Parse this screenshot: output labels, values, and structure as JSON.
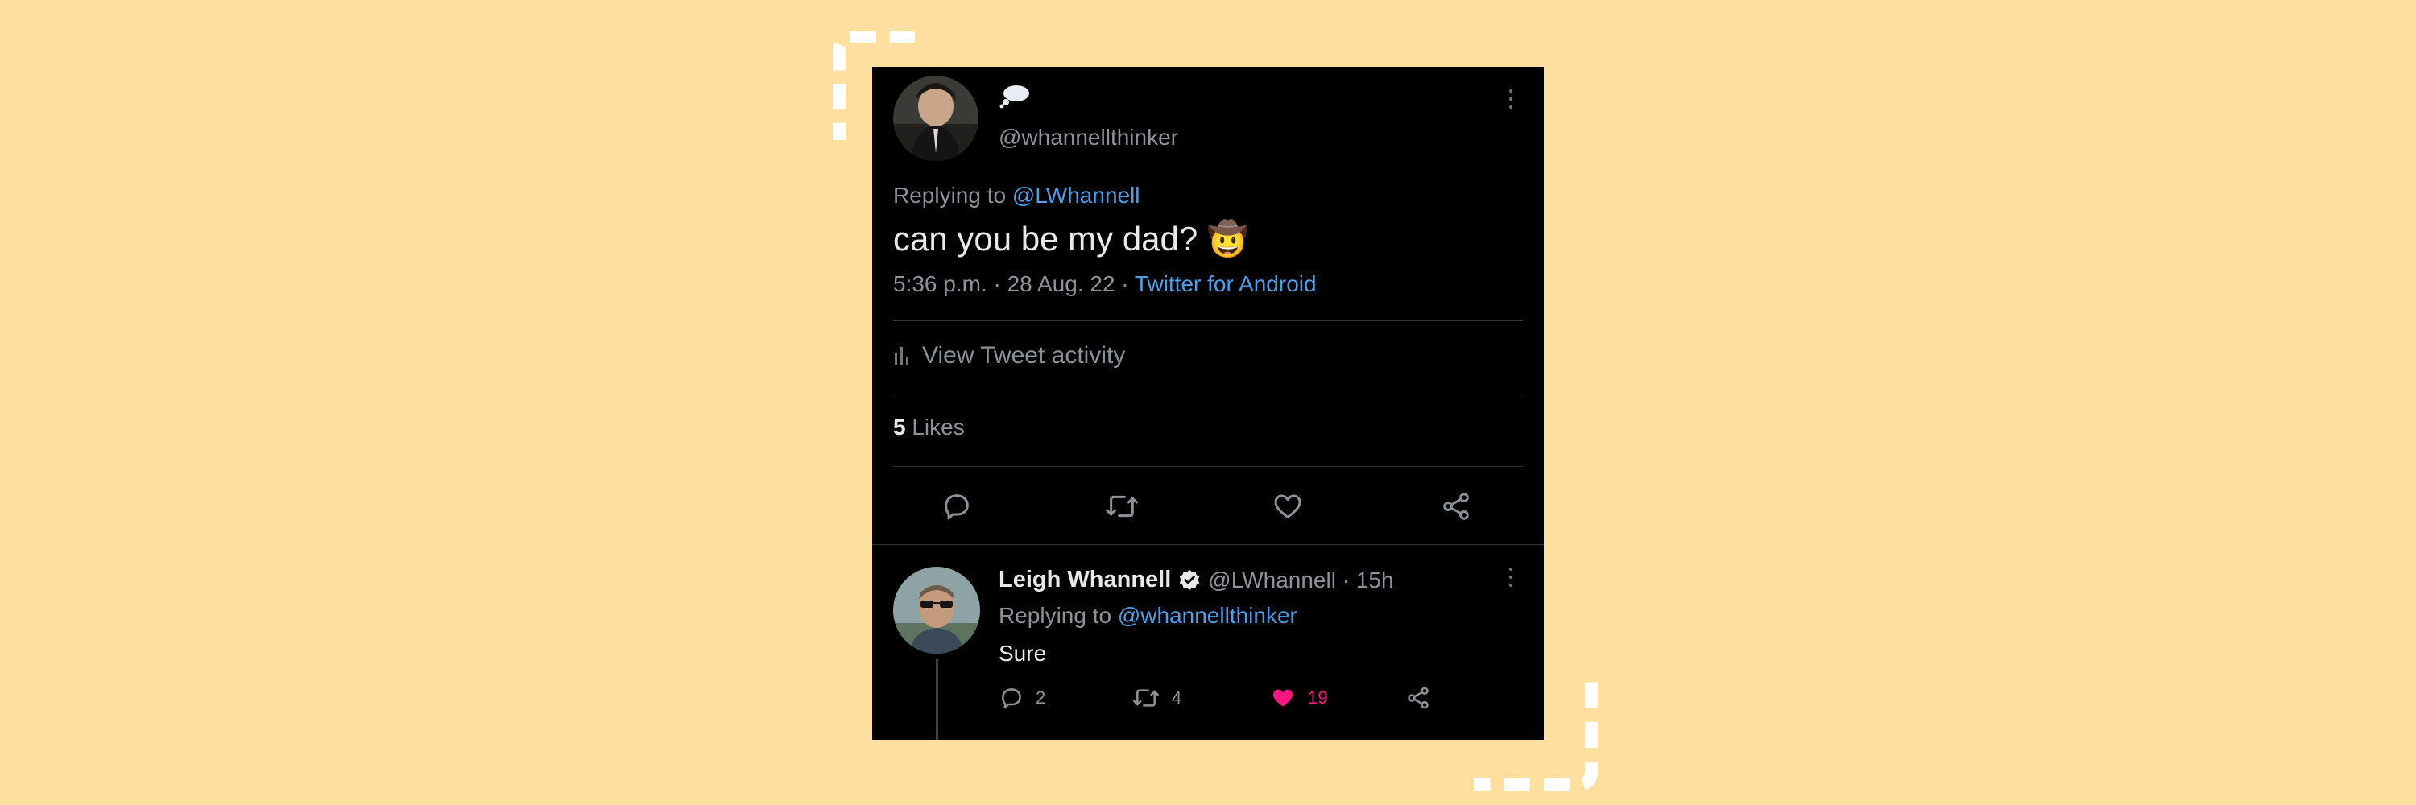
{
  "tweet": {
    "display_name_icon": "thought-bubble-icon",
    "handle": "@whannellthinker",
    "replying_prefix": "Replying to",
    "replying_to": "@LWhannell",
    "text": "can you be my dad? 🤠",
    "time": "5:36 p.m. · 28 Aug. 22 ·",
    "source": "Twitter for Android",
    "activity_label": "View Tweet activity",
    "likes_count": "5",
    "likes_label": "Likes",
    "actions": [
      "reply-icon",
      "retweet-icon",
      "like-icon",
      "share-icon"
    ]
  },
  "reply": {
    "name": "Leigh Whannell",
    "handle_time": "@LWhannell · 15h",
    "replying_prefix": "Replying to",
    "replying_to": "@whannellthinker",
    "text": "Sure",
    "reply_count": "2",
    "retweet_count": "4",
    "like_count": "19"
  },
  "colors": {
    "background": "#FEDF9F",
    "card": "#000000",
    "link": "#4C9FE8",
    "like": "#F91880"
  }
}
